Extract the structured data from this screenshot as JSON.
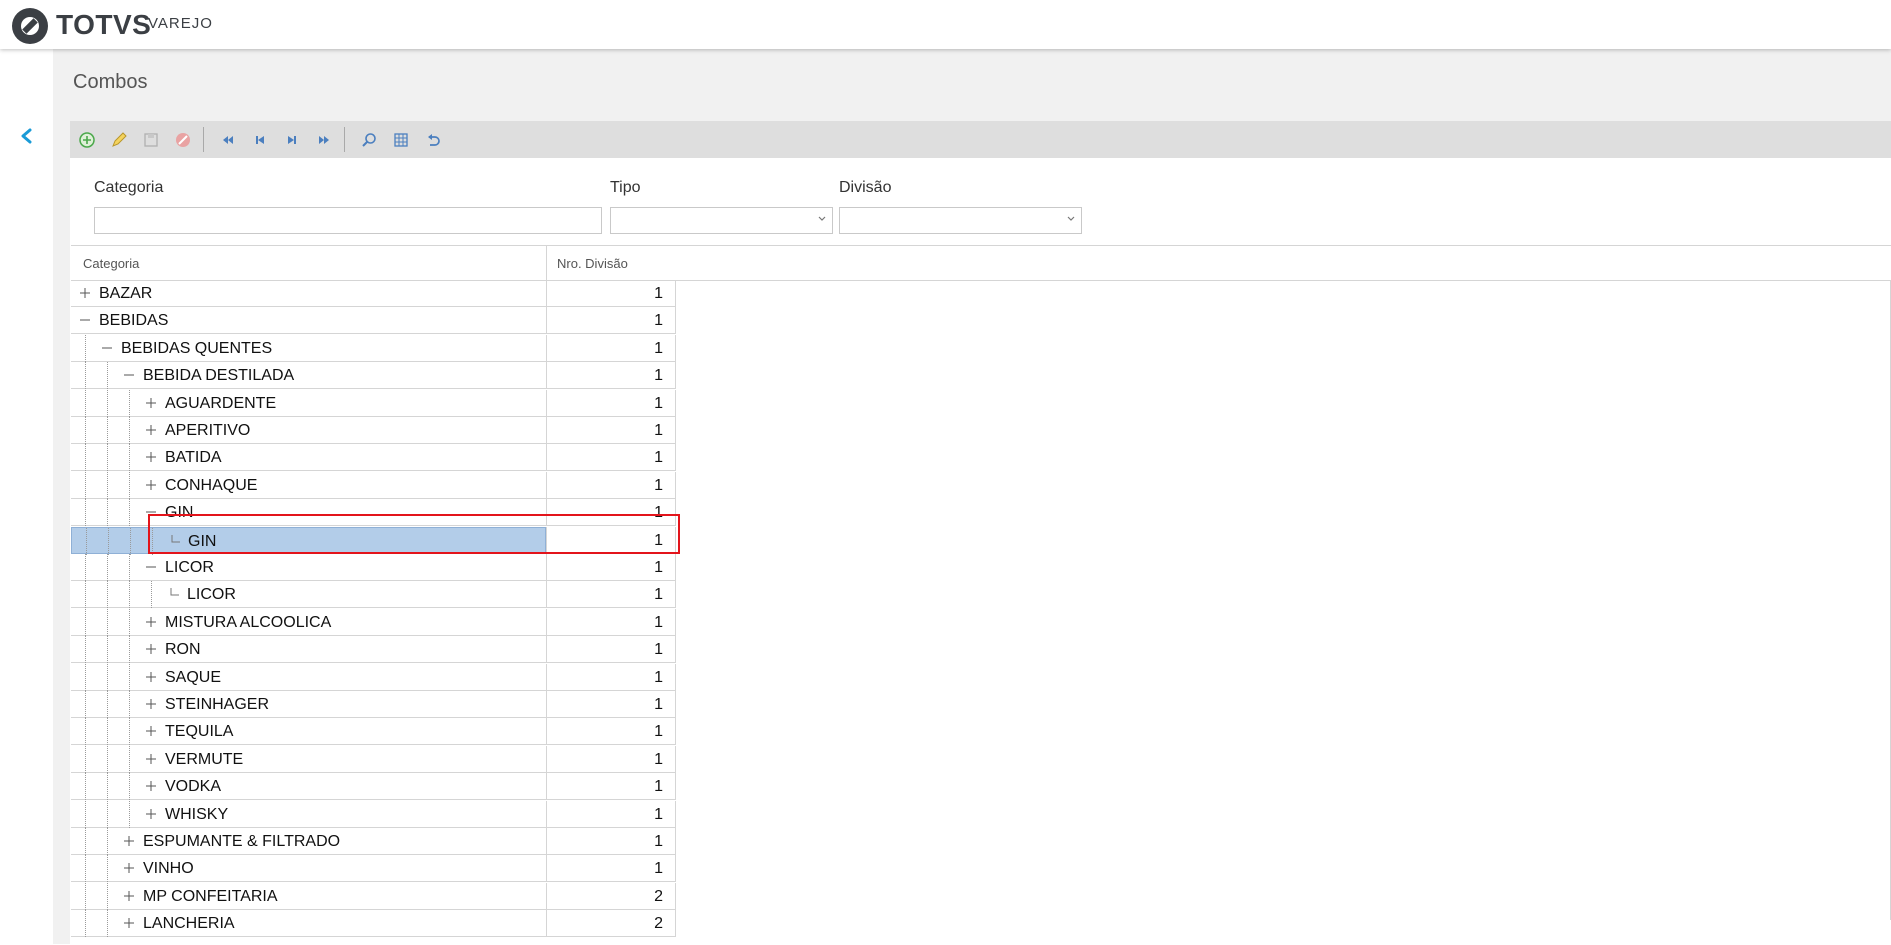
{
  "header": {
    "brand": "TOTVS",
    "product": "VAREJO"
  },
  "page": {
    "title": "Combos"
  },
  "toolbar": {
    "buttons": [
      {
        "name": "add",
        "icon": "plus-circle-icon"
      },
      {
        "name": "edit",
        "icon": "pencil-icon"
      },
      {
        "name": "save",
        "icon": "floppy-disk-icon"
      },
      {
        "name": "cancel",
        "icon": "cancel-circle-icon"
      },
      {
        "name": "first",
        "icon": "skip-first-icon"
      },
      {
        "name": "previous",
        "icon": "previous-icon"
      },
      {
        "name": "next",
        "icon": "next-icon"
      },
      {
        "name": "last",
        "icon": "skip-last-icon"
      },
      {
        "name": "search",
        "icon": "search-icon"
      },
      {
        "name": "grid",
        "icon": "grid-icon"
      },
      {
        "name": "undo",
        "icon": "undo-icon"
      }
    ]
  },
  "filters": {
    "categoria": {
      "label": "Categoria",
      "value": ""
    },
    "tipo": {
      "label": "Tipo",
      "value": ""
    },
    "divisao": {
      "label": "Divisão",
      "value": ""
    }
  },
  "grid": {
    "columns": [
      "Categoria",
      "Nro. Divisão"
    ],
    "rows": [
      {
        "label": "BAZAR",
        "value": "1",
        "level": 0,
        "state": "collapsed"
      },
      {
        "label": "BEBIDAS",
        "value": "1",
        "level": 0,
        "state": "expanded"
      },
      {
        "label": "BEBIDAS QUENTES",
        "value": "1",
        "level": 1,
        "state": "expanded"
      },
      {
        "label": "BEBIDA DESTILADA",
        "value": "1",
        "level": 2,
        "state": "expanded"
      },
      {
        "label": "AGUARDENTE",
        "value": "1",
        "level": 3,
        "state": "collapsed"
      },
      {
        "label": "APERITIVO",
        "value": "1",
        "level": 3,
        "state": "collapsed"
      },
      {
        "label": "BATIDA",
        "value": "1",
        "level": 3,
        "state": "collapsed"
      },
      {
        "label": "CONHAQUE",
        "value": "1",
        "level": 3,
        "state": "collapsed"
      },
      {
        "label": "GIN",
        "value": "1",
        "level": 3,
        "state": "expanded"
      },
      {
        "label": "GIN",
        "value": "1",
        "level": 4,
        "state": "leaf",
        "selected": true
      },
      {
        "label": "LICOR",
        "value": "1",
        "level": 3,
        "state": "expanded"
      },
      {
        "label": "LICOR",
        "value": "1",
        "level": 4,
        "state": "leaf"
      },
      {
        "label": "MISTURA ALCOOLICA",
        "value": "1",
        "level": 3,
        "state": "collapsed"
      },
      {
        "label": "RON",
        "value": "1",
        "level": 3,
        "state": "collapsed"
      },
      {
        "label": "SAQUE",
        "value": "1",
        "level": 3,
        "state": "collapsed"
      },
      {
        "label": "STEINHAGER",
        "value": "1",
        "level": 3,
        "state": "collapsed"
      },
      {
        "label": "TEQUILA",
        "value": "1",
        "level": 3,
        "state": "collapsed"
      },
      {
        "label": "VERMUTE",
        "value": "1",
        "level": 3,
        "state": "collapsed"
      },
      {
        "label": "VODKA",
        "value": "1",
        "level": 3,
        "state": "collapsed"
      },
      {
        "label": "WHISKY",
        "value": "1",
        "level": 3,
        "state": "collapsed"
      },
      {
        "label": "ESPUMANTE & FILTRADO",
        "value": "1",
        "level": 2,
        "state": "collapsed"
      },
      {
        "label": "VINHO",
        "value": "1",
        "level": 2,
        "state": "collapsed"
      },
      {
        "label": "MP CONFEITARIA",
        "value": "2",
        "level": 2,
        "state": "collapsed"
      },
      {
        "label": "LANCHERIA",
        "value": "2",
        "level": 2,
        "state": "collapsed"
      }
    ]
  },
  "colors": {
    "accent": "#1a9bd7",
    "selection": "#b3cde9",
    "highlight_box": "#e3141b"
  }
}
